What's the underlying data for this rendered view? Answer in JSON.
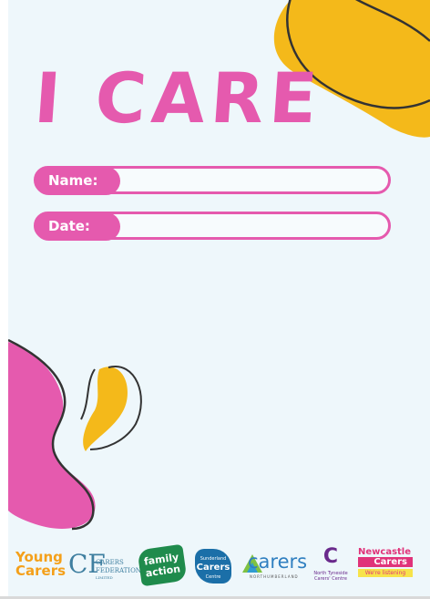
{
  "title": "I CARE",
  "fields": [
    {
      "label": "Name:",
      "value": ""
    },
    {
      "label": "Date:",
      "value": ""
    }
  ],
  "colors": {
    "pink": "#e55aae",
    "yellow": "#f4b91a",
    "background": "#eef7fb",
    "outline": "#333333"
  },
  "logos": {
    "young_carers": {
      "line1": "Young",
      "line2": "Carers"
    },
    "carers_federation": {
      "mark": "CF",
      "line1": "CARERS",
      "line2": "FEDERATION",
      "line3": "LIMITED"
    },
    "family_action": {
      "line1": "family",
      "line2": "action"
    },
    "sunderland_carers": {
      "line1": "Sunderland",
      "line2": "Carers",
      "line3": "Centre"
    },
    "carers_northumberland": {
      "word": "carers",
      "sub": "NORTHUMBERLAND"
    },
    "north_tyneside": {
      "mark": "C",
      "line1": "North Tyneside",
      "line2": "Carers' Centre"
    },
    "newcastle_carers": {
      "line1": "Newcastle",
      "line2": "Carers",
      "tagline": "We're listening"
    }
  }
}
